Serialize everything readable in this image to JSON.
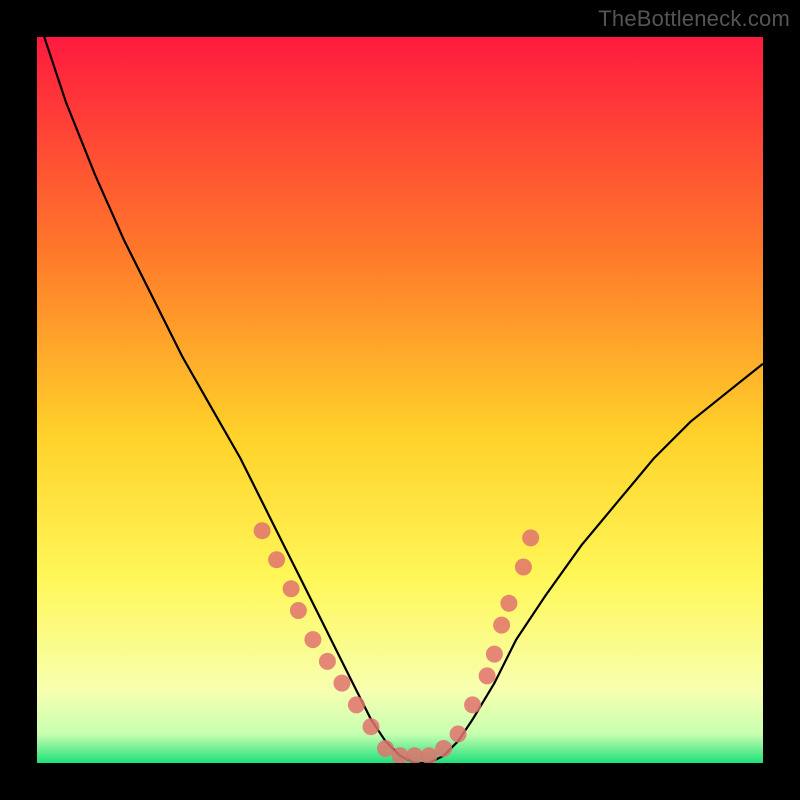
{
  "watermark": "TheBottleneck.com",
  "colors": {
    "bg": "#000000",
    "grad_top": "#ff1a3f",
    "grad_mid1": "#ff7a2a",
    "grad_mid2": "#ffd22a",
    "grad_mid3": "#fff85a",
    "grad_mid4": "#f7ffb0",
    "grad_bottom": "#1fe07a",
    "curve": "#000000",
    "marker": "#e0726f"
  },
  "chart_data": {
    "type": "line",
    "title": "",
    "xlabel": "",
    "ylabel": "",
    "xlim": [
      0,
      100
    ],
    "ylim": [
      0,
      100
    ],
    "series": [
      {
        "name": "bottleneck-curve",
        "x": [
          1,
          4,
          8,
          12,
          16,
          20,
          24,
          28,
          30,
          32,
          34,
          36,
          38,
          40,
          42,
          44,
          46,
          48,
          50,
          52,
          54,
          56,
          58,
          60,
          63,
          66,
          70,
          75,
          80,
          85,
          90,
          95,
          100
        ],
        "y": [
          100,
          91,
          81,
          72,
          64,
          56,
          49,
          42,
          38,
          34,
          30,
          26,
          22,
          18,
          14,
          10,
          6,
          3,
          1,
          0,
          0,
          1,
          3,
          6,
          11,
          17,
          23,
          30,
          36,
          42,
          47,
          51,
          55
        ]
      }
    ],
    "markers": [
      {
        "x": 31,
        "y": 32
      },
      {
        "x": 33,
        "y": 28
      },
      {
        "x": 35,
        "y": 24
      },
      {
        "x": 36,
        "y": 21
      },
      {
        "x": 38,
        "y": 17
      },
      {
        "x": 40,
        "y": 14
      },
      {
        "x": 42,
        "y": 11
      },
      {
        "x": 44,
        "y": 8
      },
      {
        "x": 46,
        "y": 5
      },
      {
        "x": 48,
        "y": 2
      },
      {
        "x": 50,
        "y": 1
      },
      {
        "x": 52,
        "y": 1
      },
      {
        "x": 54,
        "y": 1
      },
      {
        "x": 56,
        "y": 2
      },
      {
        "x": 58,
        "y": 4
      },
      {
        "x": 60,
        "y": 8
      },
      {
        "x": 62,
        "y": 12
      },
      {
        "x": 63,
        "y": 15
      },
      {
        "x": 64,
        "y": 19
      },
      {
        "x": 65,
        "y": 22
      },
      {
        "x": 67,
        "y": 27
      },
      {
        "x": 68,
        "y": 31
      }
    ],
    "gradient_stops": [
      {
        "pos": 0.0,
        "color": "#ff1a3f"
      },
      {
        "pos": 0.3,
        "color": "#ff7a2a"
      },
      {
        "pos": 0.55,
        "color": "#ffd22a"
      },
      {
        "pos": 0.75,
        "color": "#fff85a"
      },
      {
        "pos": 0.9,
        "color": "#f7ffb0"
      },
      {
        "pos": 0.96,
        "color": "#c8ffb0"
      },
      {
        "pos": 1.0,
        "color": "#1fe07a"
      }
    ]
  }
}
